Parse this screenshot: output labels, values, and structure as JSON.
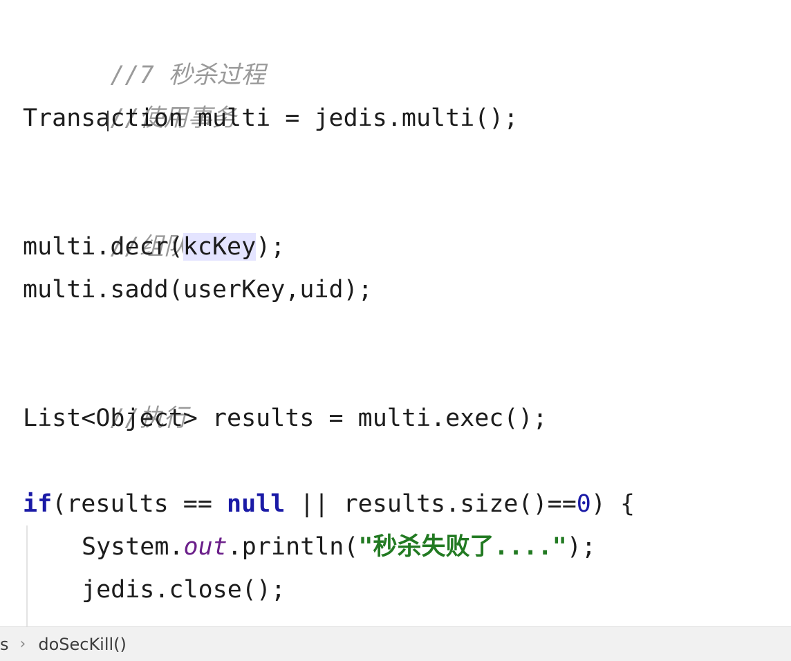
{
  "code": {
    "comment_1": "//7 秒杀过程",
    "comment_2": "//使用事务",
    "line_tx_a": "Transa",
    "line_tx_b": "ction multi = jedis.multi();",
    "comment_3": "//组队操作",
    "line_decr_a": "multi.decr(",
    "line_decr_var": "kcKey",
    "line_decr_b": ");",
    "line_sadd": "multi.sadd(userKey,uid);",
    "comment_4": "//执行",
    "line_exec": "List<Object> results = multi.exec();",
    "if_kw": "if",
    "if_mid": "(results == ",
    "null_kw": "null",
    "if_or": " || results.size()==",
    "if_zero": "0",
    "if_end": ") {",
    "println_a": "System.",
    "println_field": "out",
    "println_b": ".println(",
    "println_str": "\"秒杀失败了....\"",
    "println_c": ");",
    "close_line": "jedis.close();"
  },
  "statusbar": {
    "crumb_parent": "s",
    "separator": "›",
    "crumb_method": "doSecKill()"
  }
}
